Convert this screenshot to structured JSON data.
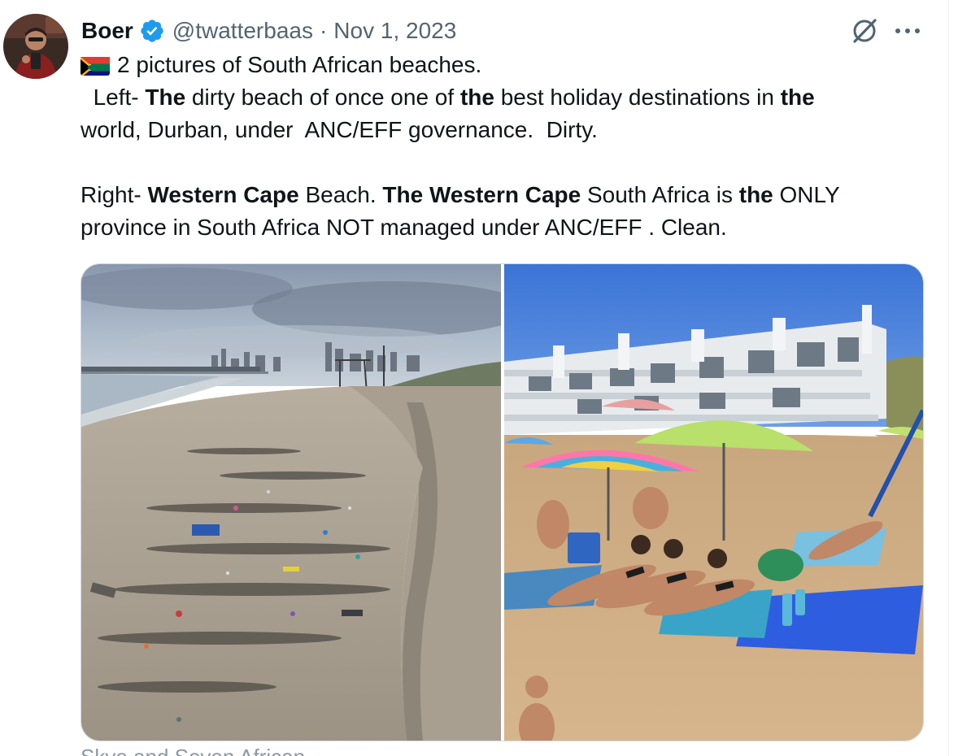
{
  "tweet": {
    "display_name": "Boer",
    "verified": true,
    "verified_icon": "verified-badge-icon",
    "handle": "@twatterbaas",
    "separator": "·",
    "date": "Nov 1, 2023",
    "flag_icon": "south-africa-flag-icon",
    "text_lines": {
      "line1": "2 pictures of South African beaches.",
      "l2_a": "  Left- ",
      "l2_b": "The",
      "l2_c": " dirty beach of once one of ",
      "l2_d": "the",
      "l2_e": " best holiday destinations in ",
      "l2_f": "the",
      "line3": "world, Durban, under  ANC/EFF governance.  Dirty.",
      "l5_a": "Right- ",
      "l5_b": "Western Cape",
      "l5_c": " Beach. ",
      "l5_d": "The Western Cape",
      "l5_e": " South Africa is ",
      "l5_f": "the",
      "l5_g": " ONLY",
      "line6": "province in South Africa NOT managed under ANC/EFF . Clean."
    },
    "caption_below": "Skye and Seven African"
  },
  "actions": {
    "grok_icon": "grok-icon",
    "more_icon": "more-options-icon"
  },
  "media": {
    "left_photo": "dirty-beach-durban-photo",
    "right_photo": "clean-beach-western-cape-photo"
  },
  "colors": {
    "text_primary": "#0f1419",
    "text_secondary": "#536471",
    "verified_blue": "#1d9bf0",
    "media_border": "#cfd9de"
  }
}
